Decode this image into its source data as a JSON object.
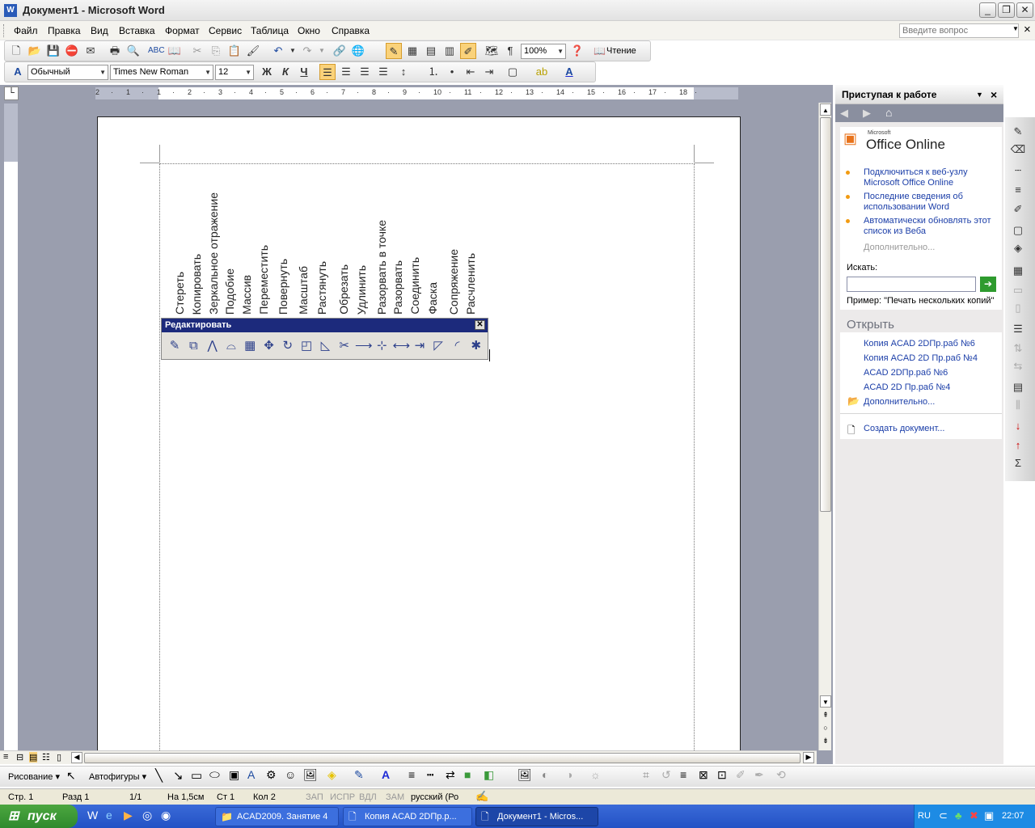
{
  "window": {
    "title": "Документ1 - Microsoft Word",
    "min": "_",
    "max": "❐",
    "close": "✕"
  },
  "menu": {
    "items": [
      "Файл",
      "Правка",
      "Вид",
      "Вставка",
      "Формат",
      "Сервис",
      "Таблица",
      "Окно",
      "Справка"
    ],
    "help_placeholder": "Введите вопрос",
    "help_close": "×"
  },
  "toolbar": {
    "zoom": "100%",
    "read_label": "Чтение",
    "style": "Обычный",
    "font": "Times New Roman",
    "size": "12",
    "bold": "Ж",
    "italic": "К",
    "underline": "Ч",
    "pilcrow": "¶"
  },
  "ruler": {
    "marks": [
      "2",
      "·",
      "1",
      "·",
      "1",
      "·",
      "2",
      "·",
      "3",
      "·",
      "4",
      "·",
      "5",
      "·",
      "6",
      "·",
      "7",
      "·",
      "8",
      "·",
      "9",
      "·",
      "10",
      "·",
      "11",
      "·",
      "12",
      "·",
      "13",
      "·",
      "14",
      "·",
      "15",
      "·",
      "16",
      "·",
      "17",
      "·",
      "18",
      "·"
    ]
  },
  "document": {
    "words": [
      "Стереть",
      "Копировать",
      "Зеркальное отражение",
      "Подобие",
      "Массив",
      "Переместить",
      "Повернуть",
      "Масштаб",
      "Растянуть",
      "Обрезать",
      "Удлинить",
      "Разорвать в точке",
      "Разорвать",
      "Соединить",
      "Фаска",
      "Сопряжение",
      "Расчленить"
    ]
  },
  "palette": {
    "title": "Редактировать",
    "close": "✕",
    "tools": [
      "erase-icon",
      "copy-icon",
      "mirror-icon",
      "offset-icon",
      "array-icon",
      "move-icon",
      "rotate-icon",
      "scale-icon",
      "stretch-icon",
      "trim-icon",
      "extend-icon",
      "break-at-point-icon",
      "break-icon",
      "join-icon",
      "chamfer-icon",
      "fillet-icon",
      "explode-icon"
    ]
  },
  "taskpane": {
    "title": "Приступая к работе",
    "close": "×",
    "logo_small": "Microsoft",
    "logo": "Office Online",
    "links": [
      "Подключиться к веб-узлу Microsoft Office Online",
      "Последние сведения об использовании Word",
      "Автоматически обновлять этот список из Веба"
    ],
    "more": "Дополнительно...",
    "search_label": "Искать:",
    "example": "Пример:  \"Печать нескольких копий\"",
    "open_title": "Открыть",
    "files": [
      "Копия ACAD 2DПр.раб №6",
      "Копия ACAD 2D Пр.раб №4",
      "ACAD 2DПр.раб №6",
      "ACAD 2D Пр.раб №4"
    ],
    "open_more": "Дополнительно...",
    "create": "Создать документ..."
  },
  "drawbar": {
    "draw": "Рисование",
    "autoshapes": "Автофигуры"
  },
  "status": {
    "page": "Стр. 1",
    "section": "Разд 1",
    "pages": "1/1",
    "at": "На 1,5см",
    "line": "Ст 1",
    "col": "Кол 2",
    "rec": "ЗАП",
    "trk": "ИСПР",
    "ext": "ВДЛ",
    "ovr": "ЗАМ",
    "lang": "русский (Ро"
  },
  "taskbar": {
    "start": "пуск",
    "tasks": [
      "ACAD2009. Занятие 4",
      "Копия ACAD 2DПр.р...",
      "Документ1 - Micros..."
    ],
    "lang": "RU",
    "time": "22:07"
  }
}
